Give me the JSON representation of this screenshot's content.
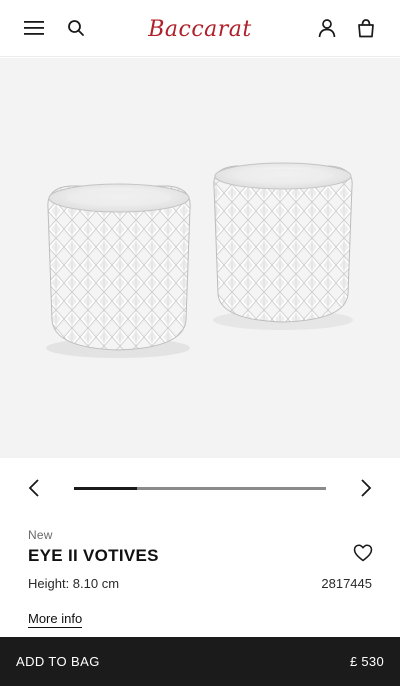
{
  "header": {
    "logo_text": "Baccarat",
    "logo_color": "#b0202a",
    "icons": [
      "hamburger-menu-icon",
      "search-icon",
      "user-icon",
      "shopping-bag-icon"
    ]
  },
  "gallery": {
    "background": "#f3f3f3",
    "carousel_progress": 0.25,
    "icons": [
      "chevron-left-icon",
      "chevron-right-icon"
    ]
  },
  "product": {
    "badge": "New",
    "name": "EYE II VOTIVES",
    "height": "Height: 8.10 cm",
    "reference": "2817445",
    "more_info_label": "More info",
    "wishlist_icon": "heart-icon"
  },
  "cta": {
    "label": "ADD TO BAG",
    "price": "£ 530",
    "background": "#1b1b1b"
  }
}
